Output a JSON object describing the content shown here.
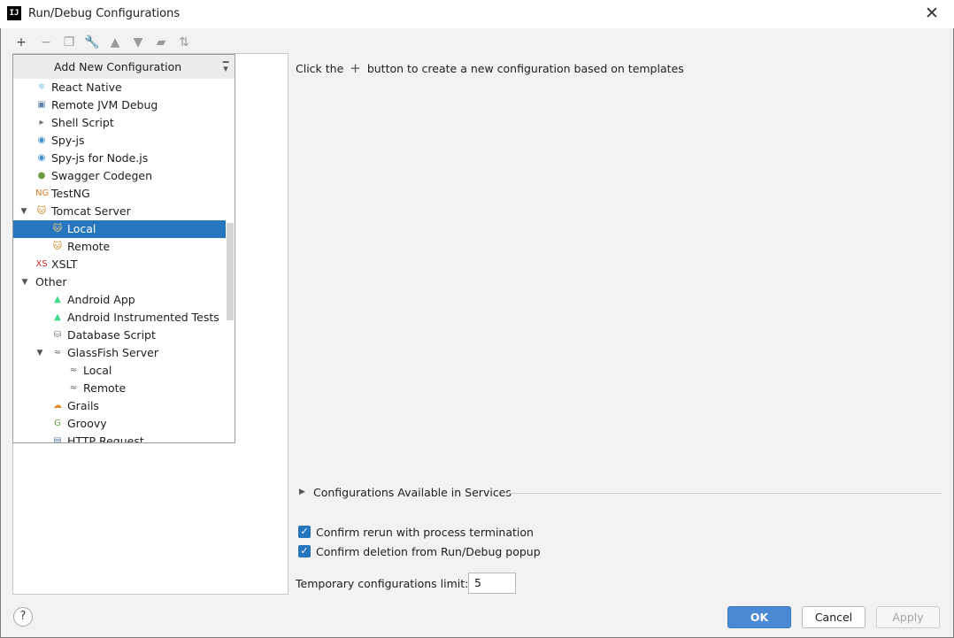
{
  "window": {
    "title": "Run/Debug Configurations",
    "app_icon_text": "IJ"
  },
  "toolbar": [
    {
      "name": "add-icon",
      "glyph": "+",
      "enabled": true
    },
    {
      "name": "remove-icon",
      "glyph": "−",
      "enabled": false
    },
    {
      "name": "copy-icon",
      "glyph": "❐",
      "enabled": false
    },
    {
      "name": "wrench-icon",
      "glyph": "🔧",
      "enabled": true
    },
    {
      "name": "move-up-icon",
      "glyph": "▲",
      "enabled": false
    },
    {
      "name": "move-down-icon",
      "glyph": "▼",
      "enabled": false
    },
    {
      "name": "folder-icon",
      "glyph": "▰",
      "enabled": false
    },
    {
      "name": "sort-icon",
      "glyph": "⇅",
      "enabled": false
    }
  ],
  "popup": {
    "title": "Add New Configuration",
    "items": [
      {
        "label": "React Native",
        "icon": "react-icon",
        "glyph": "⚛",
        "color": "#3aa8d8",
        "level": 1
      },
      {
        "label": "Remote JVM Debug",
        "icon": "remote-debug-icon",
        "glyph": "▣",
        "color": "#5c7fa8",
        "level": 1
      },
      {
        "label": "Shell Script",
        "icon": "shell-script-icon",
        "glyph": "▸",
        "color": "#6b6b6b",
        "level": 1
      },
      {
        "label": "Spy-js",
        "icon": "spy-js-icon",
        "glyph": "◉",
        "color": "#3f8fcf",
        "level": 1
      },
      {
        "label": "Spy-js for Node.js",
        "icon": "spy-js-node-icon",
        "glyph": "◉",
        "color": "#3f8fcf",
        "level": 1
      },
      {
        "label": "Swagger Codegen",
        "icon": "swagger-icon",
        "glyph": "●",
        "color": "#6a9a3a",
        "level": 1
      },
      {
        "label": "TestNG",
        "icon": "testng-icon",
        "glyph": "NG",
        "color": "#d97a2b",
        "level": 1
      },
      {
        "label": "Tomcat Server",
        "icon": "tomcat-icon",
        "glyph": "🐱",
        "color": "#c98a2b",
        "level": 1,
        "expanded": true
      },
      {
        "label": "Local",
        "icon": "tomcat-icon",
        "glyph": "🐱",
        "color": "#c98a2b",
        "level": 2,
        "selected": true
      },
      {
        "label": "Remote",
        "icon": "tomcat-icon",
        "glyph": "🐱",
        "color": "#c98a2b",
        "level": 2
      },
      {
        "label": "XSLT",
        "icon": "xslt-icon",
        "glyph": "XS",
        "color": "#d02b2b",
        "level": 1
      },
      {
        "label": "Other",
        "icon": "",
        "glyph": "",
        "color": "#333333",
        "level": 0,
        "expanded": true
      },
      {
        "label": "Android App",
        "icon": "android-icon",
        "glyph": "▲",
        "color": "#3ddc84",
        "level": 2
      },
      {
        "label": "Android Instrumented Tests",
        "icon": "android-icon",
        "glyph": "▲",
        "color": "#3ddc84",
        "level": 2
      },
      {
        "label": "Database Script",
        "icon": "database-icon",
        "glyph": "⛁",
        "color": "#6b6b6b",
        "level": 2
      },
      {
        "label": "GlassFish Server",
        "icon": "glassfish-icon",
        "glyph": "≈",
        "color": "#6b6b6b",
        "level": 2,
        "expanded": true
      },
      {
        "label": "Local",
        "icon": "glassfish-icon",
        "glyph": "≈",
        "color": "#6b6b6b",
        "level": 3
      },
      {
        "label": "Remote",
        "icon": "glassfish-icon",
        "glyph": "≈",
        "color": "#6b6b6b",
        "level": 3
      },
      {
        "label": "Grails",
        "icon": "grails-icon",
        "glyph": "☁",
        "color": "#e88a2b",
        "level": 2
      },
      {
        "label": "Groovy",
        "icon": "groovy-icon",
        "glyph": "G",
        "color": "#5fa84a",
        "level": 2
      },
      {
        "label": "HTTP Request",
        "icon": "http-request-icon",
        "glyph": "▤",
        "color": "#5c7fa8",
        "level": 2
      }
    ]
  },
  "main": {
    "hint_before": "Click the",
    "hint_plus": "+",
    "hint_after": "button to create a new configuration based on templates",
    "services_label": "Configurations Available in Services",
    "confirm_rerun": {
      "label": "Confirm rerun with process termination",
      "checked": true
    },
    "confirm_deletion": {
      "label": "Confirm deletion from Run/Debug popup",
      "checked": true
    },
    "temp_limit_label": "Temporary configurations limit:",
    "temp_limit_value": "5"
  },
  "footer": {
    "help": "?",
    "ok": "OK",
    "cancel": "Cancel",
    "apply": "Apply"
  }
}
